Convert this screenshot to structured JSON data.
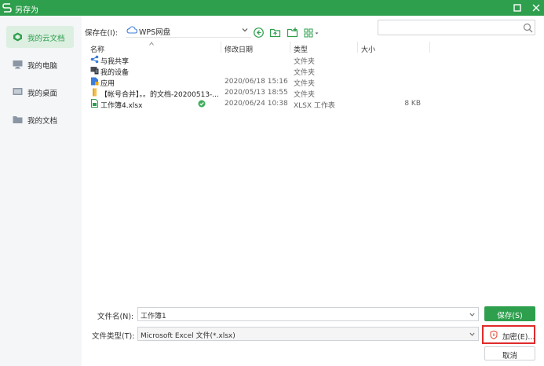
{
  "window": {
    "title": "另存为",
    "accent": "#2e9f4d"
  },
  "sidebar": {
    "items": [
      {
        "label": "我的云文档",
        "icon": "cloud-docs-icon",
        "active": true
      },
      {
        "label": "我的电脑",
        "icon": "computer-icon",
        "active": false
      },
      {
        "label": "我的桌面",
        "icon": "desktop-icon",
        "active": false
      },
      {
        "label": "我的文档",
        "icon": "folder-icon",
        "active": false
      }
    ]
  },
  "location": {
    "label": "保存在(I):",
    "value": "WPS网盘"
  },
  "search": {
    "placeholder": "",
    "value": ""
  },
  "file_list": {
    "columns": [
      "名称",
      "修改日期",
      "类型",
      "大小"
    ],
    "rows": [
      {
        "name": "与我共享",
        "date": "",
        "type": "文件夹",
        "size": "",
        "icon": "share-icon"
      },
      {
        "name": "我的设备",
        "date": "",
        "type": "文件夹",
        "size": "",
        "icon": "device-icon"
      },
      {
        "name": "应用",
        "date": "2020/06/18 15:16",
        "type": "文件夹",
        "size": "",
        "icon": "app-folder-icon"
      },
      {
        "name": "【帐号合并】。。的文档-20200513-...",
        "date": "2020/05/13 18:55",
        "type": "文件夹",
        "size": "",
        "icon": "folder-icon"
      },
      {
        "name": "工作簿4.xlsx",
        "date": "2020/06/24 10:38",
        "type": "XLSX 工作表",
        "size": "8 KB",
        "icon": "xlsx-file-icon"
      }
    ]
  },
  "form": {
    "filename_label": "文件名(N):",
    "filename_value": "工作簿1",
    "filetype_label": "文件类型(T):",
    "filetype_value": "Microsoft Excel 文件(*.xlsx)"
  },
  "buttons": {
    "save": "保存(S)",
    "encrypt": "加密(E)...",
    "cancel": "取消"
  }
}
